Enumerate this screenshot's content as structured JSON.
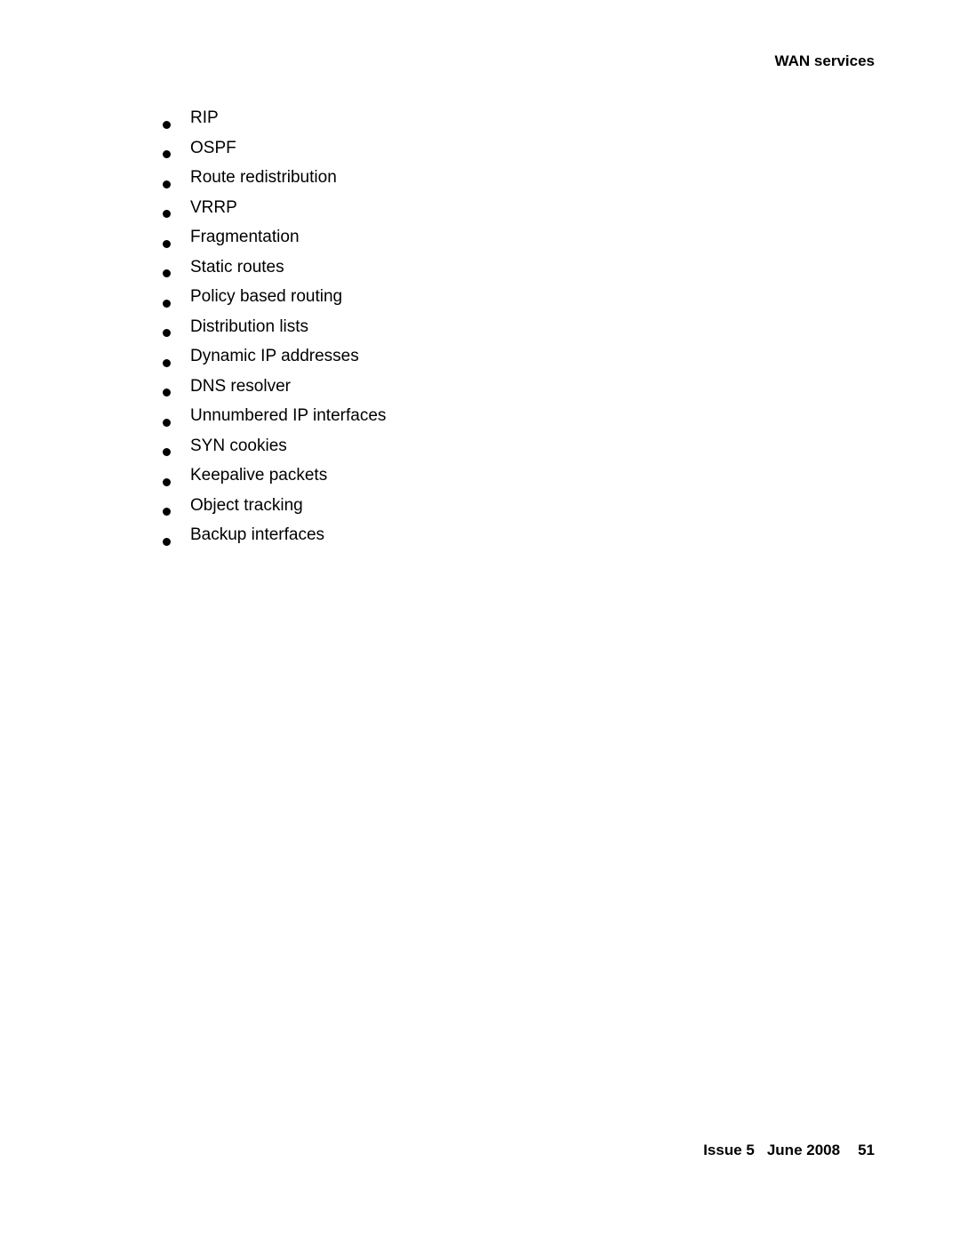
{
  "header": {
    "section_title": "WAN services"
  },
  "feature_list": {
    "items": [
      "RIP",
      "OSPF",
      "Route redistribution",
      "VRRP",
      "Fragmentation",
      "Static routes",
      "Policy based routing",
      "Distribution lists",
      "Dynamic IP addresses",
      "DNS resolver",
      "Unnumbered IP interfaces",
      "SYN cookies",
      "Keepalive packets",
      "Object tracking",
      "Backup interfaces"
    ]
  },
  "footer": {
    "issue": "Issue 5",
    "date": "June 2008",
    "page_number": "51"
  }
}
